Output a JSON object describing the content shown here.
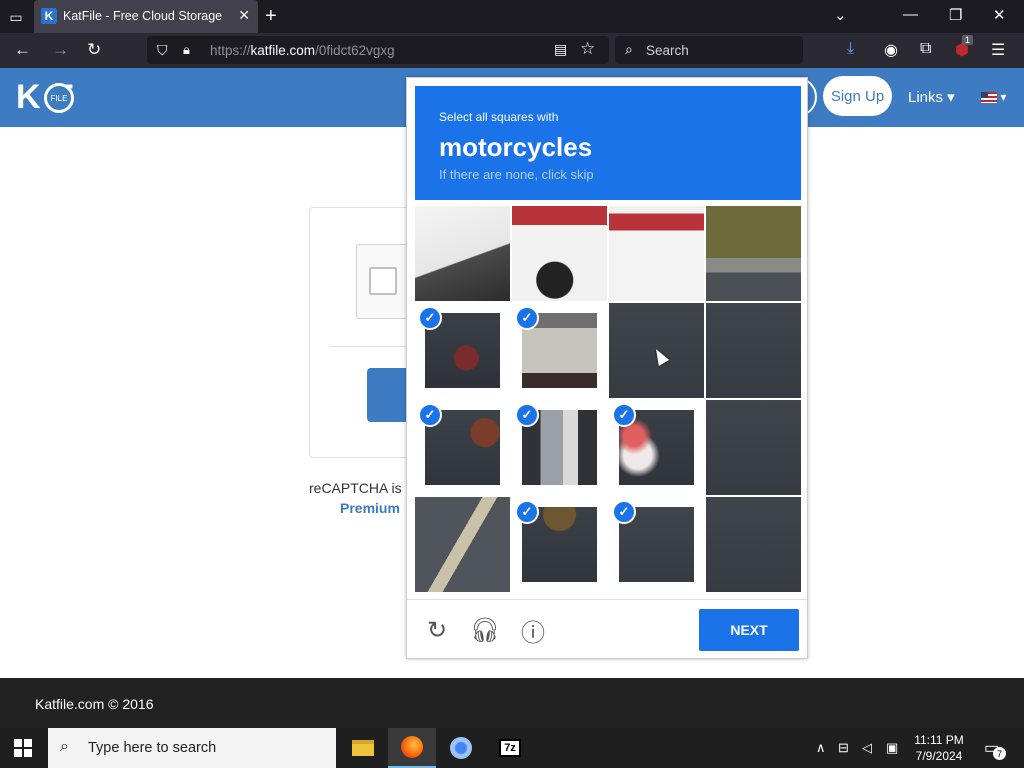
{
  "browser": {
    "tab_title": "KatFile - Free Cloud Storage",
    "tab_favicon_letter": "K",
    "url_prefix": "https://",
    "url_host": "katfile.com",
    "url_path": "/0fidct62vgxg",
    "search_placeholder": "Search",
    "extension_badge": "1",
    "icons": {
      "tab_list": "tab-list-icon",
      "close": "close-icon",
      "new_tab": "plus-icon",
      "back": "arrow-left-icon",
      "forward": "arrow-right-icon",
      "reload": "reload-icon",
      "download": "download-icon",
      "menu": "hamburger-icon"
    }
  },
  "site": {
    "logo_text": "K  T",
    "logo_badge": "FILE",
    "signup_label": "Sign Up",
    "links_label": "Links ▾",
    "brand_color": "#3d7bc2"
  },
  "page": {
    "recaptcha_note": "reCAPTCHA is",
    "premium_label": "Premium"
  },
  "footer": {
    "copyright": "Katfile.com © 2016"
  },
  "captcha": {
    "instruction": "Select all squares with",
    "keyword": "motorcycles",
    "hint": "If there are none, click skip",
    "next_label": "NEXT",
    "accent_color": "#1a73e8",
    "grid_rows": 4,
    "grid_cols": 4,
    "tiles": [
      {
        "row": 0,
        "col": 0,
        "selected": false,
        "scene": "white-car-rear"
      },
      {
        "row": 0,
        "col": 1,
        "selected": false,
        "scene": "car-taillight-helmet"
      },
      {
        "row": 0,
        "col": 2,
        "selected": false,
        "scene": "car-taillight"
      },
      {
        "row": 0,
        "col": 3,
        "selected": false,
        "scene": "grass-road-edge"
      },
      {
        "row": 1,
        "col": 0,
        "selected": true,
        "scene": "motorcycle-front"
      },
      {
        "row": 1,
        "col": 1,
        "selected": true,
        "scene": "rider-shirt"
      },
      {
        "row": 1,
        "col": 2,
        "selected": false,
        "scene": "asphalt"
      },
      {
        "row": 1,
        "col": 3,
        "selected": false,
        "scene": "asphalt"
      },
      {
        "row": 2,
        "col": 0,
        "selected": true,
        "scene": "wheel-asphalt"
      },
      {
        "row": 2,
        "col": 1,
        "selected": true,
        "scene": "motorcycle-body"
      },
      {
        "row": 2,
        "col": 2,
        "selected": true,
        "scene": "taillight-blur"
      },
      {
        "row": 2,
        "col": 3,
        "selected": false,
        "scene": "asphalt"
      },
      {
        "row": 3,
        "col": 0,
        "selected": false,
        "scene": "road-marking"
      },
      {
        "row": 3,
        "col": 1,
        "selected": true,
        "scene": "rear-wheel"
      },
      {
        "row": 3,
        "col": 2,
        "selected": true,
        "scene": "asphalt"
      },
      {
        "row": 3,
        "col": 3,
        "selected": false,
        "scene": "asphalt"
      }
    ],
    "icons": {
      "reload": "reload-icon",
      "audio": "headphones-icon",
      "info": "info-icon",
      "check": "checkmark-icon"
    }
  },
  "taskbar": {
    "search_placeholder": "Type here to search",
    "time": "11:11 PM",
    "date": "7/9/2024",
    "notification_count": "7",
    "seven_zip_label": "7z",
    "apps": [
      "file-explorer",
      "firefox",
      "chrome",
      "7-zip"
    ]
  }
}
